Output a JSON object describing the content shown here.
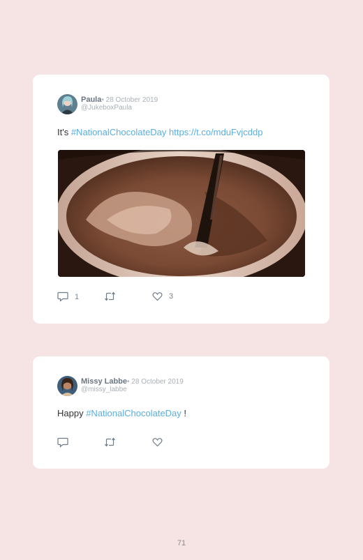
{
  "tweets": [
    {
      "name": "Paula",
      "date": "• 28 October 2019",
      "handle": "@JukeboxPaula",
      "text_before": "It's ",
      "hashtag": "#NationalChocolateDay",
      "text_middle": " ",
      "url": "https://t.co/mduFvjcddp",
      "replies": "1",
      "retweets": "",
      "likes": "3"
    },
    {
      "name": "Missy Labbe",
      "date": "• 28 October 2019",
      "handle": "@missy_labbe",
      "text_before": "Happy ",
      "hashtag": "#NationalChocolateDay",
      "text_after": " !",
      "replies": "",
      "retweets": "",
      "likes": ""
    }
  ],
  "page_number": "71",
  "colors": {
    "background": "#f6e4e5",
    "link": "#5aaee0"
  }
}
